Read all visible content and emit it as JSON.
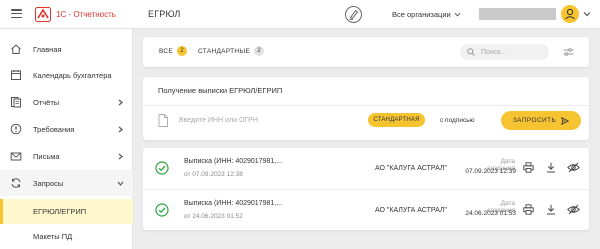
{
  "header": {
    "brand": "1С - Отчетность",
    "page_title": "ЕГРЮЛ",
    "org_select": "Все организации"
  },
  "sidebar": {
    "items": [
      {
        "label": "Главная",
        "icon": "home-icon"
      },
      {
        "label": "Календарь бухгалтера",
        "icon": "calendar-icon"
      },
      {
        "label": "Отчёты",
        "icon": "reports-icon"
      },
      {
        "label": "Требования",
        "icon": "requirements-icon"
      },
      {
        "label": "Письма",
        "icon": "mail-icon"
      },
      {
        "label": "Запросы",
        "icon": "requests-icon"
      }
    ],
    "subitems": [
      {
        "label": "ЕГРЮЛ/ЕГРИП"
      },
      {
        "label": "Макеты ПД"
      }
    ]
  },
  "filters": {
    "tabs": [
      {
        "label": "ВСЕ",
        "count": "2"
      },
      {
        "label": "СТАНДАРТНЫЕ",
        "count": "2"
      }
    ],
    "search_placeholder": "Поиск..."
  },
  "request": {
    "title": "Получение выписки ЕГРЮЛ/ЕГРИП",
    "input_placeholder": "Введите ИНН или ОГРН",
    "type_standard": "СТАНДАРТНАЯ",
    "type_signed": "с подписью",
    "submit": "ЗАПРОСИТЬ"
  },
  "list": {
    "rows": [
      {
        "title": "Выписка (ИНН: 4029017981,...",
        "subtitle": "от 07.09.2023 12:38",
        "org": "АО \"КАЛУГА АСТРАЛ\"",
        "date_label": "Дата создания",
        "date": "07.09.2023 12:39"
      },
      {
        "title": "Выписка (ИНН: 4029017981,...",
        "subtitle": "от 24.06.2023 01:52",
        "org": "АО \"КАЛУГА АСТРАЛ\"",
        "date_label": "Дата создания",
        "date": "24.06.2023 01:53"
      }
    ]
  },
  "colors": {
    "accent": "#f6c431",
    "brand_red": "#e4312b",
    "success": "#2aa63f"
  }
}
